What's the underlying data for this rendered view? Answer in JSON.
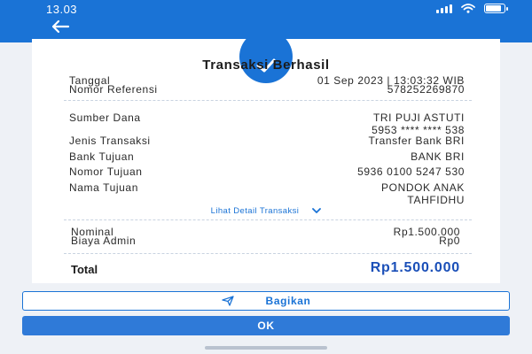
{
  "status_bar": {
    "time": "13.03",
    "icons": [
      "signal-icon",
      "wifi-icon",
      "battery-icon"
    ]
  },
  "header": {
    "back_icon": "arrow-left-icon"
  },
  "receipt": {
    "status_icon": "check-icon",
    "title": "Transaksi Berhasil",
    "rows": [
      {
        "label": "Tanggal",
        "value": "01 Sep 2023 | 13:03:32 WIB"
      },
      {
        "label": "Nomor Referensi",
        "value": "578252269870"
      },
      {
        "label": "Sumber Dana",
        "value": "TRI PUJI ASTUTI",
        "value2": "5953 **** **** 538"
      },
      {
        "label": "Jenis Transaksi",
        "value": "Transfer Bank BRI"
      },
      {
        "label": "Bank Tujuan",
        "value": "BANK BRI"
      },
      {
        "label": "Nomor Tujuan",
        "value": "5936 0100 5247 530"
      },
      {
        "label": "Nama Tujuan",
        "value": "PONDOK ANAK",
        "value2": "TAHFIDHU"
      }
    ],
    "detail_link": "Lihat Detail Transaksi",
    "summary": [
      {
        "label": "Nominal",
        "value": "Rp1.500.000"
      },
      {
        "label": "Biaya Admin",
        "value": "Rp0"
      }
    ],
    "total": {
      "label": "Total",
      "value": "Rp1.500.000"
    }
  },
  "actions": {
    "share_label": "Bagikan",
    "share_icon": "send-icon",
    "ok_label": "OK"
  },
  "colors": {
    "primary": "#1a73d6",
    "total_text": "#1a4fb8",
    "background": "#eef1f6"
  }
}
